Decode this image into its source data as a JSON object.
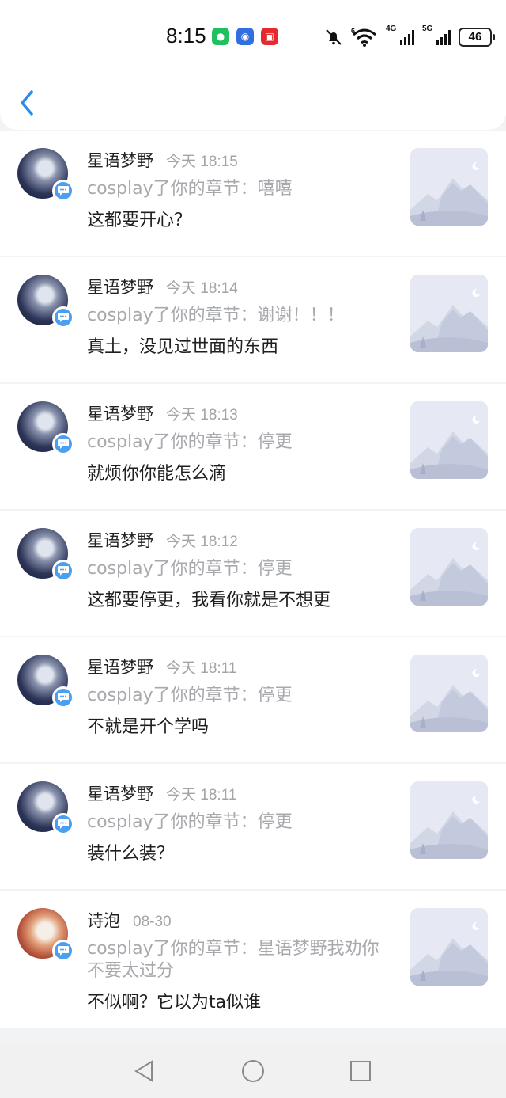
{
  "status_bar": {
    "time": "8:15",
    "app_icons": [
      {
        "name": "wechat-icon",
        "color": "#1fc15f",
        "glyph": "●"
      },
      {
        "name": "app-blue-icon",
        "color": "#2f6fe0",
        "glyph": "◉"
      },
      {
        "name": "huawei-appgallery-icon",
        "color": "#e6282f",
        "glyph": "▣"
      }
    ],
    "network_1": "4G",
    "network_2": "5G",
    "wifi_label": "6",
    "battery": "46"
  },
  "header": {
    "back_icon": "chevron-left-icon",
    "accent_color": "#2a8ee8"
  },
  "notifications": [
    {
      "name": "星语梦野",
      "time": "今天 18:15",
      "reply": "cosplay了你的章节：嘻嘻",
      "message": "这都要开心？",
      "avatar": "anime-night"
    },
    {
      "name": "星语梦野",
      "time": "今天 18:14",
      "reply": "cosplay了你的章节：谢谢！！！",
      "message": "真土，没见过世面的东西",
      "avatar": "anime-night"
    },
    {
      "name": "星语梦野",
      "time": "今天 18:13",
      "reply": "cosplay了你的章节：停更",
      "message": "就烦你你能怎么滴",
      "avatar": "anime-night"
    },
    {
      "name": "星语梦野",
      "time": "今天 18:12",
      "reply": "cosplay了你的章节：停更",
      "message": "这都要停更，我看你就是不想更",
      "avatar": "anime-night"
    },
    {
      "name": "星语梦野",
      "time": "今天 18:11",
      "reply": "cosplay了你的章节：停更",
      "message": "不就是开个学吗",
      "avatar": "anime-night"
    },
    {
      "name": "星语梦野",
      "time": "今天 18:11",
      "reply": "cosplay了你的章节：停更",
      "message": "装什么装？",
      "avatar": "anime-night"
    },
    {
      "name": "诗泡",
      "time": "08-30",
      "reply": "cosplay了你的章节：星语梦野我劝你不要太过分",
      "message": "不似啊？它以为ta似谁",
      "avatar": "anime-warm"
    }
  ],
  "nav_bar": {
    "back": "triangle-back-icon",
    "home": "circle-home-icon",
    "recents": "square-recents-icon"
  }
}
